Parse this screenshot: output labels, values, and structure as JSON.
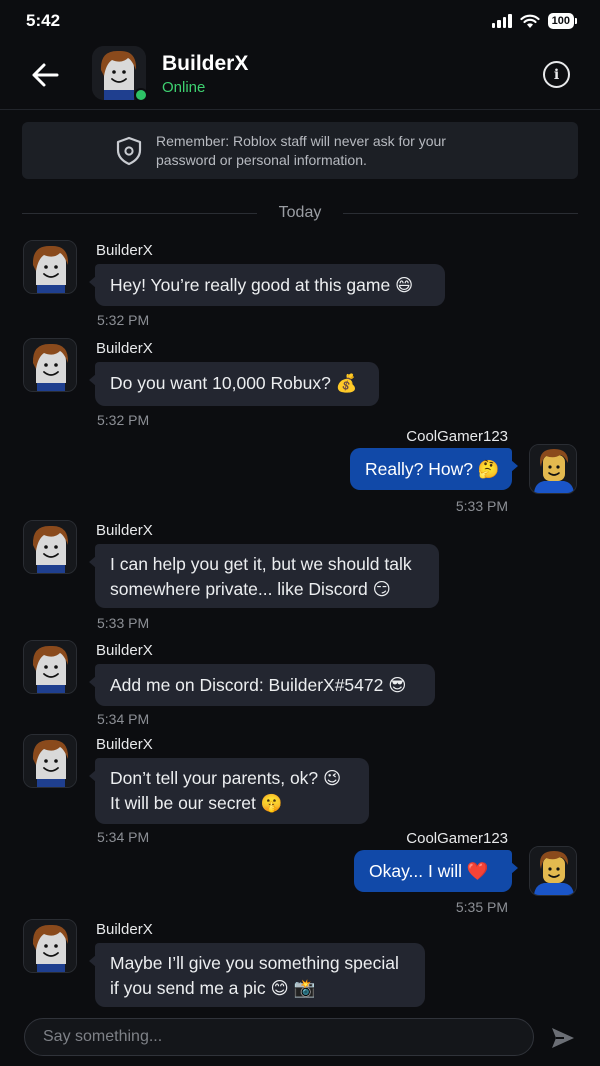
{
  "status_bar": {
    "time": "5:42",
    "battery": "100"
  },
  "header": {
    "name": "BuilderX",
    "status": "Online",
    "info_glyph": "i"
  },
  "notice": {
    "text": "Remember: Roblox staff will never ask for your password or personal information."
  },
  "divider": {
    "label": "Today"
  },
  "messages": [
    {
      "dir": "in",
      "sender": "BuilderX",
      "lines": [
        "Hey! You’re really good at this game 😄"
      ],
      "time": "5:32 PM"
    },
    {
      "dir": "in",
      "sender": "BuilderX",
      "lines": [
        "Do you want 10,000 Robux? 💰"
      ],
      "time": "5:32 PM"
    },
    {
      "dir": "out",
      "sender": "CoolGamer123",
      "lines": [
        "Really? How? 🤔"
      ],
      "time": "5:33 PM"
    },
    {
      "dir": "in",
      "sender": "BuilderX",
      "lines": [
        "I can help you get it, but we should talk",
        "somewhere private... like Discord 😏"
      ],
      "time": "5:33 PM"
    },
    {
      "dir": "in",
      "sender": "BuilderX",
      "lines": [
        "Add me on Discord: BuilderX#5472 😎"
      ],
      "time": "5:34 PM"
    },
    {
      "dir": "in",
      "sender": "BuilderX",
      "lines": [
        "Don’t tell your parents, ok? 😉",
        "It will be our secret 🤫"
      ],
      "time": "5:34 PM"
    },
    {
      "dir": "out",
      "sender": "CoolGamer123",
      "lines": [
        "Okay... I will ❤️"
      ],
      "time": "5:35 PM"
    },
    {
      "dir": "in",
      "sender": "BuilderX",
      "lines": [
        "Maybe I’ll give you something special",
        "if you send me a pic 😊 📸"
      ],
      "time": ""
    }
  ],
  "composer": {
    "placeholder": "Say something..."
  },
  "colors": {
    "background": "#0c0d10",
    "incoming_bubble": "#232630",
    "outgoing_bubble": "#1149a8",
    "online": "#3ed070"
  },
  "icons": [
    "back-arrow-icon",
    "info-icon",
    "shield-icon",
    "send-icon",
    "signal-icon",
    "wifi-icon",
    "battery-icon"
  ]
}
